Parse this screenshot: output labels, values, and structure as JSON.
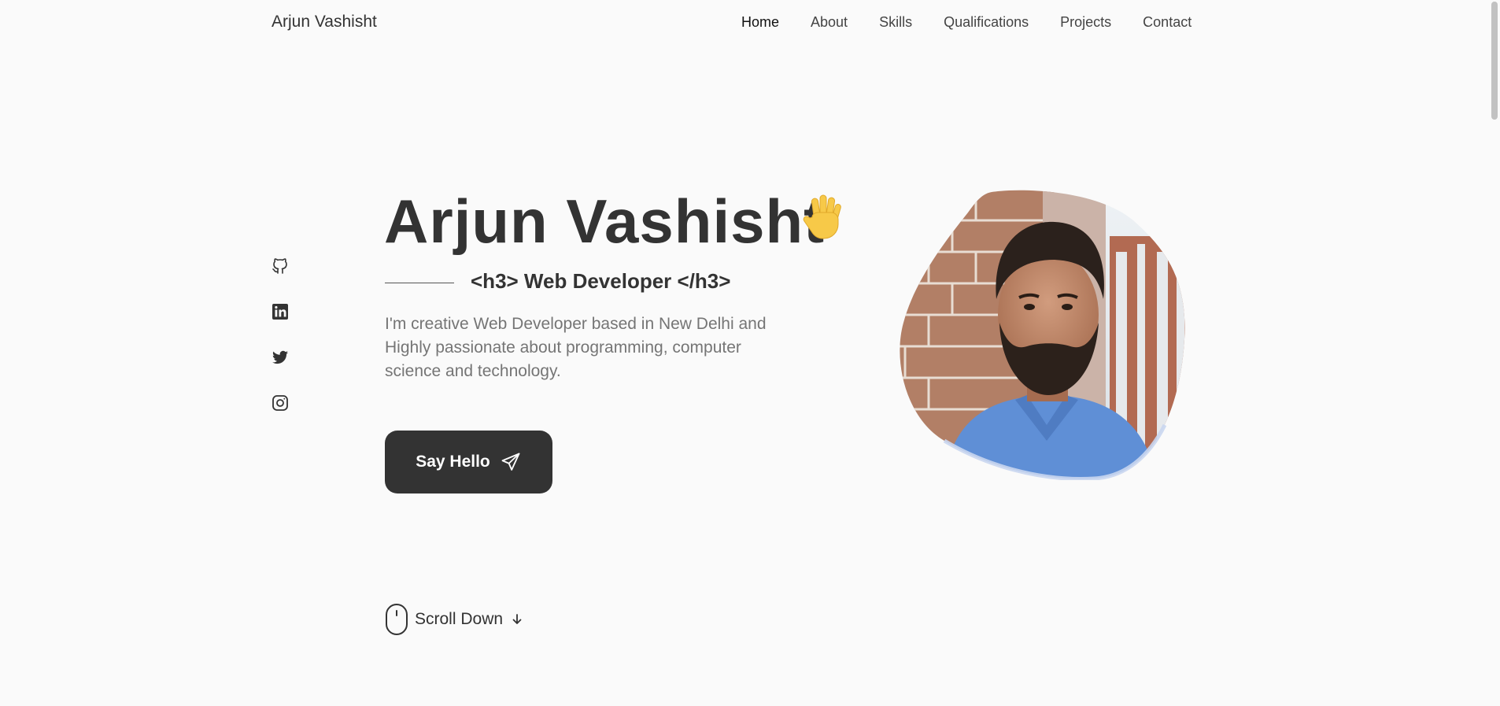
{
  "header": {
    "logo": "Arjun Vashisht",
    "nav": [
      {
        "label": "Home",
        "active": true
      },
      {
        "label": "About"
      },
      {
        "label": "Skills"
      },
      {
        "label": "Qualifications"
      },
      {
        "label": "Projects"
      },
      {
        "label": "Contact"
      }
    ]
  },
  "social": [
    {
      "icon": "github-icon"
    },
    {
      "icon": "linkedin-icon"
    },
    {
      "icon": "twitter-icon"
    },
    {
      "icon": "instagram-icon"
    }
  ],
  "hero": {
    "title": "Arjun Vashisht",
    "title_emoji": "waving-hand",
    "subtitle": "<h3> Web Developer </h3>",
    "description": "I'm creative Web Developer based in New Delhi and Highly passionate about programming, computer science and technology.",
    "cta_label": "Say Hello",
    "cta_icon": "send-icon"
  },
  "scroll": {
    "label": "Scroll Down"
  },
  "colors": {
    "background": "#fafafa",
    "text": "#333333",
    "muted": "#757575",
    "button": "#333333",
    "blob_border": "#c9d6ef"
  }
}
